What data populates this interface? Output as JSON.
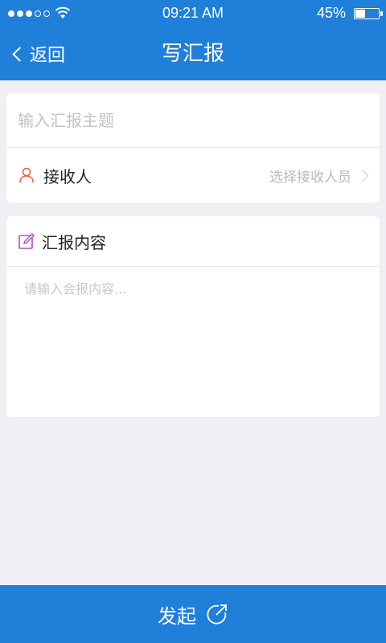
{
  "status_bar": {
    "time": "09:21 AM",
    "battery_percent": "45%",
    "battery_level": 0.45,
    "signal_bars_filled": 3,
    "signal_bars_total": 5
  },
  "nav": {
    "back_label": "返回",
    "title": "写汇报"
  },
  "form": {
    "subject_placeholder": "输入汇报主题",
    "receiver_label": "接收人",
    "receiver_hint": "选择接收人员",
    "content_label": "汇报内容",
    "content_placeholder": "请输入会报内容..."
  },
  "footer": {
    "submit_label": "发起"
  },
  "colors": {
    "primary": "#1f7fd9",
    "background": "#efeff4",
    "receiver_icon": "#e8603c",
    "content_icon": "#b04fc4"
  },
  "icons": {
    "receiver": "person-icon",
    "content": "edit-icon",
    "submit": "share-arrow-icon"
  }
}
